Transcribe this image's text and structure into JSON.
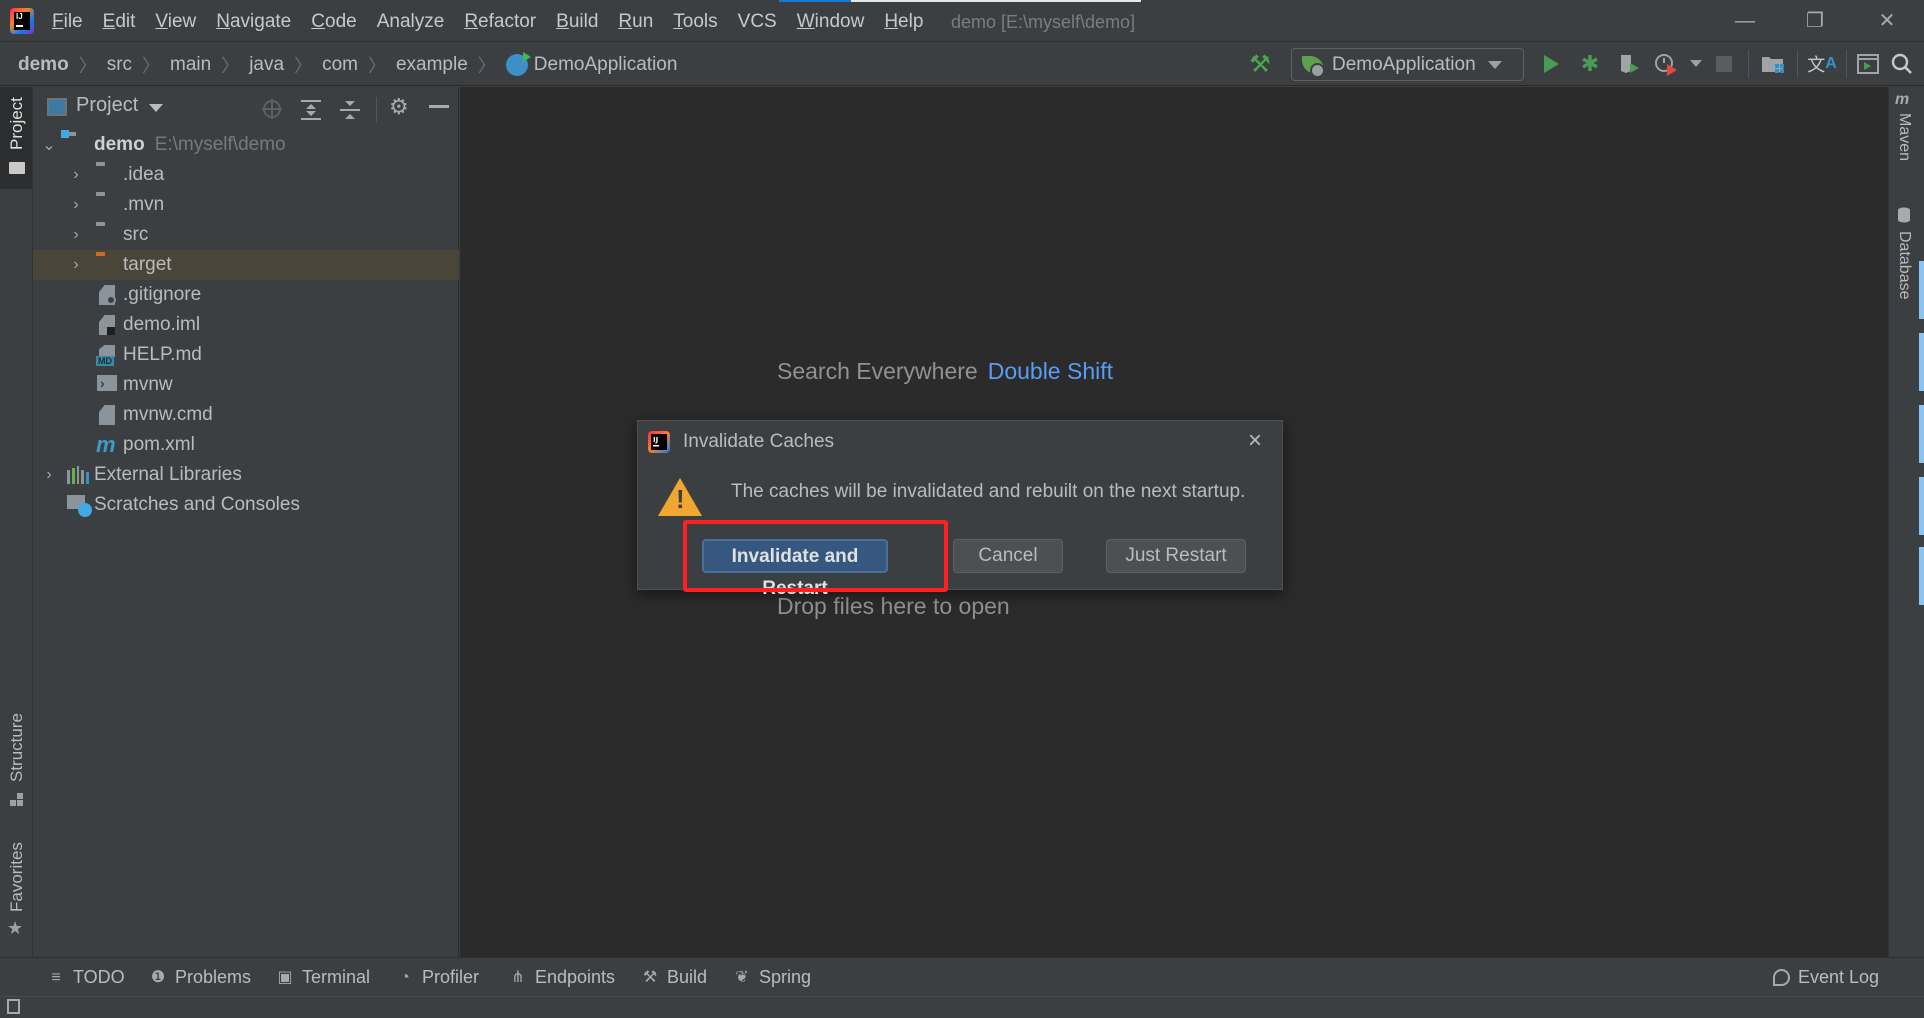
{
  "menubar": {
    "items": [
      {
        "label": "File",
        "mnemonic": "F",
        "rest": "ile"
      },
      {
        "label": "Edit",
        "mnemonic": "E",
        "rest": "dit"
      },
      {
        "label": "View",
        "mnemonic": "V",
        "rest": "iew"
      },
      {
        "label": "Navigate",
        "mnemonic": "N",
        "rest": "avigate"
      },
      {
        "label": "Code",
        "mnemonic": "C",
        "rest": "ode"
      },
      {
        "label": "Analyze",
        "mnemonic": "",
        "rest": "Analyze"
      },
      {
        "label": "Refactor",
        "mnemonic": "R",
        "rest": "efactor"
      },
      {
        "label": "Build",
        "mnemonic": "B",
        "rest": "uild"
      },
      {
        "label": "Run",
        "mnemonic": "R",
        "rest": "un"
      },
      {
        "label": "Tools",
        "mnemonic": "T",
        "rest": "ools"
      },
      {
        "label": "VCS",
        "mnemonic": "",
        "rest": "VCS"
      },
      {
        "label": "Window",
        "mnemonic": "W",
        "rest": "indow"
      },
      {
        "label": "Help",
        "mnemonic": "H",
        "rest": "elp"
      }
    ],
    "window_title": "demo [E:\\myself\\demo]",
    "window_controls": [
      "minimize",
      "restore",
      "close"
    ]
  },
  "navbar": {
    "breadcrumbs": [
      "demo",
      "src",
      "main",
      "java",
      "com",
      "example",
      "DemoApplication"
    ],
    "run_config": "DemoApplication",
    "icons": [
      "build-hammer-icon",
      "run-icon",
      "debug-icon",
      "coverage-icon",
      "profiler-icon",
      "stop-icon",
      "project-structure-icon",
      "translate-icon",
      "run-anything-icon",
      "search-icon"
    ]
  },
  "left_strip": {
    "tabs": [
      "Project",
      "Structure",
      "Favorites"
    ]
  },
  "right_strip": {
    "tabs": [
      "Maven",
      "Database"
    ]
  },
  "project_panel": {
    "title": "Project",
    "tree": [
      {
        "label": "demo",
        "hint": "E:\\myself\\demo",
        "type": "module",
        "level": 0,
        "expanded": true
      },
      {
        "label": ".idea",
        "type": "folder",
        "level": 1
      },
      {
        "label": ".mvn",
        "type": "folder",
        "level": 1
      },
      {
        "label": "src",
        "type": "folder",
        "level": 1
      },
      {
        "label": "target",
        "type": "folder-excluded",
        "level": 1,
        "selected": true
      },
      {
        "label": ".gitignore",
        "type": "file-ignore",
        "level": 1
      },
      {
        "label": "demo.iml",
        "type": "file-iml",
        "level": 1
      },
      {
        "label": "HELP.md",
        "type": "file-md",
        "level": 1
      },
      {
        "label": "mvnw",
        "type": "file-shell",
        "level": 1
      },
      {
        "label": "mvnw.cmd",
        "type": "file-text",
        "level": 1
      },
      {
        "label": "pom.xml",
        "type": "file-maven",
        "level": 1
      },
      {
        "label": "External Libraries",
        "type": "libraries",
        "level": 0
      },
      {
        "label": "Scratches and Consoles",
        "type": "scratches",
        "level": 0
      }
    ]
  },
  "editor": {
    "search_hint": "Search Everywhere",
    "search_key": "Double Shift",
    "drop_hint": "Drop files here to open"
  },
  "dialog": {
    "title": "Invalidate Caches",
    "message": "The caches will be invalidated and rebuilt on the next startup.",
    "buttons": {
      "primary": "Invalidate and Restart",
      "cancel": "Cancel",
      "secondary": "Just Restart"
    },
    "close": "×"
  },
  "bottom_bar": {
    "tabs": [
      {
        "label": "TODO",
        "icon": "≡"
      },
      {
        "label": "Problems",
        "icon": "❶"
      },
      {
        "label": "Terminal",
        "icon": "▣"
      },
      {
        "label": "Profiler",
        "icon": "◔"
      },
      {
        "label": "Endpoints",
        "icon": "⋔"
      },
      {
        "label": "Build",
        "icon": "⚒"
      },
      {
        "label": "Spring",
        "icon": "❦"
      }
    ],
    "event_log": "Event Log"
  },
  "colors": {
    "accent_blue": "#589df6",
    "primary_button": "#365880",
    "highlight_red": "#ff2020",
    "warning": "#f0a732",
    "selected_row": "#4a4539"
  }
}
